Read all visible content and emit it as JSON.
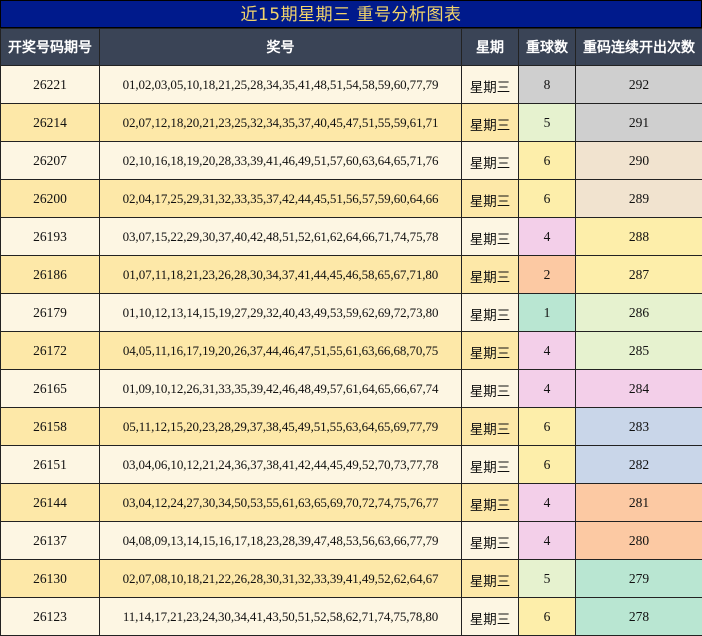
{
  "title": "近15期星期三 重号分析图表",
  "headers": [
    "开奖号码期号",
    "奖号",
    "星期",
    "重球数",
    "重码连续开出次数"
  ],
  "rows": [
    {
      "issue": "26221",
      "numbers": "01,02,03,05,10,18,21,25,28,34,35,41,48,51,54,58,59,60,77,79",
      "weekday": "星期三",
      "repeat": "8",
      "streak": "292",
      "repeat_color": "#cfcfcf",
      "streak_color": "#cfcfcf"
    },
    {
      "issue": "26214",
      "numbers": "02,07,12,18,20,21,23,25,32,34,35,37,40,45,47,51,55,59,61,71",
      "weekday": "星期三",
      "repeat": "5",
      "streak": "291",
      "repeat_color": "#e6f2cf",
      "streak_color": "#cfcfcf"
    },
    {
      "issue": "26207",
      "numbers": "02,10,16,18,19,20,28,33,39,41,46,49,51,57,60,63,64,65,71,76",
      "weekday": "星期三",
      "repeat": "6",
      "streak": "290",
      "repeat_color": "#fdeeaa",
      "streak_color": "#f1e3cf"
    },
    {
      "issue": "26200",
      "numbers": "02,04,17,25,29,31,32,33,35,37,42,44,45,51,56,57,59,60,64,66",
      "weekday": "星期三",
      "repeat": "6",
      "streak": "289",
      "repeat_color": "#fdeeaa",
      "streak_color": "#f1e3cf"
    },
    {
      "issue": "26193",
      "numbers": "03,07,15,22,29,30,37,40,42,48,51,52,61,62,64,66,71,74,75,78",
      "weekday": "星期三",
      "repeat": "4",
      "streak": "288",
      "repeat_color": "#f3cfe9",
      "streak_color": "#fdeeaa"
    },
    {
      "issue": "26186",
      "numbers": "01,07,11,18,21,23,26,28,30,34,37,41,44,45,46,58,65,67,71,80",
      "weekday": "星期三",
      "repeat": "2",
      "streak": "287",
      "repeat_color": "#fcc9a3",
      "streak_color": "#fdeeaa"
    },
    {
      "issue": "26179",
      "numbers": "01,10,12,13,14,15,19,27,29,32,40,43,49,53,59,62,69,72,73,80",
      "weekday": "星期三",
      "repeat": "1",
      "streak": "286",
      "repeat_color": "#b9e6d2",
      "streak_color": "#e6f2cf"
    },
    {
      "issue": "26172",
      "numbers": "04,05,11,16,17,19,20,26,37,44,46,47,51,55,61,63,66,68,70,75",
      "weekday": "星期三",
      "repeat": "4",
      "streak": "285",
      "repeat_color": "#f3cfe9",
      "streak_color": "#e6f2cf"
    },
    {
      "issue": "26165",
      "numbers": "01,09,10,12,26,31,33,35,39,42,46,48,49,57,61,64,65,66,67,74",
      "weekday": "星期三",
      "repeat": "4",
      "streak": "284",
      "repeat_color": "#f3cfe9",
      "streak_color": "#f3cfe9"
    },
    {
      "issue": "26158",
      "numbers": "05,11,12,15,20,23,28,29,37,38,45,49,51,55,63,64,65,69,77,79",
      "weekday": "星期三",
      "repeat": "6",
      "streak": "283",
      "repeat_color": "#fdeeaa",
      "streak_color": "#c9d6e9"
    },
    {
      "issue": "26151",
      "numbers": "03,04,06,10,12,21,24,36,37,38,41,42,44,45,49,52,70,73,77,78",
      "weekday": "星期三",
      "repeat": "6",
      "streak": "282",
      "repeat_color": "#fdeeaa",
      "streak_color": "#c9d6e9"
    },
    {
      "issue": "26144",
      "numbers": "03,04,12,24,27,30,34,50,53,55,61,63,65,69,70,72,74,75,76,77",
      "weekday": "星期三",
      "repeat": "4",
      "streak": "281",
      "repeat_color": "#f3cfe9",
      "streak_color": "#fcc9a3"
    },
    {
      "issue": "26137",
      "numbers": "04,08,09,13,14,15,16,17,18,23,28,39,47,48,53,56,63,66,77,79",
      "weekday": "星期三",
      "repeat": "4",
      "streak": "280",
      "repeat_color": "#f3cfe9",
      "streak_color": "#fcc9a3"
    },
    {
      "issue": "26130",
      "numbers": "02,07,08,10,18,21,22,26,28,30,31,32,33,39,41,49,52,62,64,67",
      "weekday": "星期三",
      "repeat": "5",
      "streak": "279",
      "repeat_color": "#e6f2cf",
      "streak_color": "#b9e6d2"
    },
    {
      "issue": "26123",
      "numbers": "11,14,17,21,23,24,30,34,41,43,50,51,52,58,62,71,74,75,78,80",
      "weekday": "星期三",
      "repeat": "6",
      "streak": "278",
      "repeat_color": "#fdeeaa",
      "streak_color": "#b9e6d2"
    }
  ]
}
